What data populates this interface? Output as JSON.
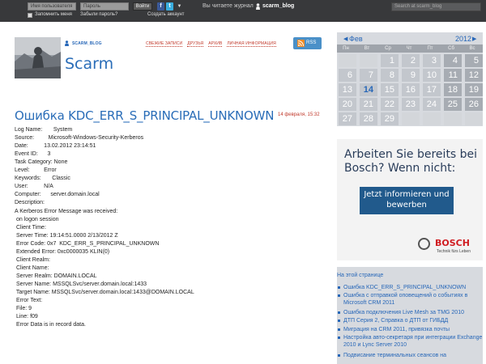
{
  "topbar": {
    "login_placeholder": "Имя пользователя",
    "password_placeholder": "Пароль",
    "login_button": "Войти",
    "remember_label": "Запомнить меня",
    "forgot_link": "Забыли пароль?",
    "create_account": "Создать аккаунт",
    "reading_label": "Вы читаете журнал",
    "journal_name": "scarm_blog",
    "search_placeholder": "Search at scarm_blog"
  },
  "profile": {
    "username": "SCARM_BLOG",
    "journal_title": "Scarm"
  },
  "nav": [
    "СВЕЖИЕ ЗАПИСИ",
    "ДРУЗЬЯ",
    "АРХИВ",
    "ЛИЧНАЯ ИНФОРМАЦИЯ"
  ],
  "rss_label": "RSS",
  "post": {
    "title": "Ошибка KDC_ERR_S_PRINCIPAL_UNKNOWN",
    "date": "14 февраля, 15:32",
    "lines": [
      "Log Name:       System",
      "Source:         Microsoft-Windows-Security-Kerberos",
      "Date:          13.02.2012 23:14:51",
      "Event ID:      3",
      "Task Category: None",
      "Level:         Error",
      "Keywords:       Classic",
      "User:          N/A",
      "Computer:      server.domain.local",
      "Description:",
      "A Kerberos Error Message was received:",
      " on logon session",
      " Client Time:",
      " Server Time: 19:14:51.0000 2/13/2012 Z",
      " Error Code: 0x7  KDC_ERR_S_PRINCIPAL_UNKNOWN",
      " Extended Error: 0xc0000035 KLIN(0)",
      " Client Realm:",
      " Client Name:",
      " Server Realm: DOMAIN.LOCAL",
      " Server Name: MSSQLSvc/server.domain.local:1433",
      " Target Name: MSSQLSvc/server.domain.local:1433@DOMAIN.LOCAL",
      " Error Text:",
      " File: 9",
      " Line: f09",
      " Error Data is in record data."
    ]
  },
  "calendar": {
    "month": "Фев",
    "year": "2012",
    "weekdays": [
      "Пн",
      "Вт",
      "Ср",
      "Чт",
      "Пт",
      "Сб",
      "Вс"
    ],
    "weeks": [
      [
        "",
        "",
        "1",
        "2",
        "3",
        "4",
        "5"
      ],
      [
        "6",
        "7",
        "8",
        "9",
        "10",
        "11",
        "12"
      ],
      [
        "13",
        "14",
        "15",
        "16",
        "17",
        "18",
        "19"
      ],
      [
        "20",
        "21",
        "22",
        "23",
        "24",
        "25",
        "26"
      ],
      [
        "27",
        "28",
        "29",
        "",
        "",
        "",
        ""
      ]
    ],
    "highlighted_day": "14"
  },
  "ad": {
    "headline": "Arbeiten Sie bereits bei Bosch? Wenn nicht:",
    "button": "Jetzt informieren und bewerben",
    "brand": "BOSCH",
    "slogan": "Technik fürs Leben"
  },
  "toc": {
    "title": "На этой странице",
    "items": [
      "Ошибка KDC_ERR_S_PRINCIPAL_UNKNOWN",
      "Ошибка с отправкой оповещений о событиях в Microsoft CRM 2011",
      "Ошибка подключения Live Mesh за TMG 2010",
      "ДТП Серия 2, Справка о ДТП от ГИБДД",
      "Миграция на CRM 2011, привязка почты",
      "Настройка авто-секретаря при интеграции Exchange 2010 и Lync Server 2010",
      "Подвисание терминальных сеансов на"
    ]
  },
  "colors": {
    "topbar": "#38393b",
    "link_blue": "#2767b8",
    "nav_red": "#c0392b",
    "calendar_bg": "#d7dadf",
    "ad_button": "#215a8c",
    "bosch_red": "#d01c21"
  }
}
